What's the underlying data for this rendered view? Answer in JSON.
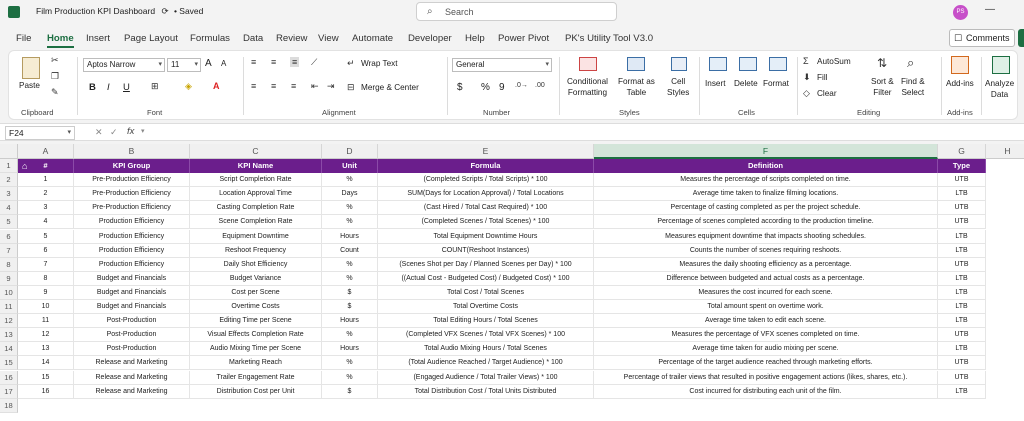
{
  "window": {
    "doc_title": "Film Production KPI Dashboard",
    "saved_status": "• Saved",
    "search_placeholder": "Search",
    "avatar_initials": "PS"
  },
  "menu": {
    "tabs": [
      "File",
      "Home",
      "Insert",
      "Page Layout",
      "Formulas",
      "Data",
      "Review",
      "View",
      "Automate",
      "Developer",
      "Help",
      "Power Pivot",
      "PK's Utility Tool V3.0"
    ],
    "active": "Home",
    "comments_label": "Comments"
  },
  "ribbon": {
    "clipboard": {
      "paste": "Paste",
      "label": "Clipboard"
    },
    "font": {
      "family": "Aptos Narrow",
      "size": "11",
      "label": "Font",
      "grow": "A",
      "shrink": "A",
      "bold": "B",
      "italic": "I",
      "underline": "U"
    },
    "alignment": {
      "wrap_text": "Wrap Text",
      "merge_center": "Merge & Center",
      "label": "Alignment"
    },
    "number": {
      "format": "General",
      "currency": "$",
      "percent": "%",
      "comma": "9",
      "label": "Number"
    },
    "styles": {
      "conditional": "Conditional",
      "conditional2": "Formatting",
      "format_table": "Format as",
      "format_table2": "Table",
      "cell_styles": "Cell",
      "cell_styles2": "Styles",
      "label": "Styles"
    },
    "cells": {
      "insert": "Insert",
      "delete": "Delete",
      "format": "Format",
      "label": "Cells"
    },
    "editing": {
      "autosum": "AutoSum",
      "fill": "Fill",
      "clear": "Clear",
      "sort": "Sort &",
      "sort2": "Filter",
      "find": "Find &",
      "find2": "Select",
      "label": "Editing"
    },
    "addins": {
      "addins": "Add-ins",
      "label": "Add-ins"
    },
    "analyze": {
      "line1": "Analyze",
      "line2": "Data"
    }
  },
  "formula_bar": {
    "name_box": "F24",
    "fx": "fx",
    "value": ""
  },
  "columns": [
    "A",
    "B",
    "C",
    "D",
    "E",
    "F",
    "G",
    "H"
  ],
  "selected_column": "F",
  "header_row": [
    "#",
    "KPI Group",
    "KPI Name",
    "Unit",
    "Formula",
    "Definition",
    "Type"
  ],
  "rows": [
    [
      "1",
      "Pre-Production Efficiency",
      "Script Completion Rate",
      "%",
      "(Completed Scripts / Total Scripts) * 100",
      "Measures the percentage of scripts completed on time.",
      "UTB"
    ],
    [
      "2",
      "Pre-Production Efficiency",
      "Location Approval Time",
      "Days",
      "SUM(Days for Location Approval) / Total Locations",
      "Average time taken to finalize filming locations.",
      "LTB"
    ],
    [
      "3",
      "Pre-Production Efficiency",
      "Casting Completion Rate",
      "%",
      "(Cast Hired / Total Cast Required) * 100",
      "Percentage of casting completed as per the project schedule.",
      "UTB"
    ],
    [
      "4",
      "Production Efficiency",
      "Scene Completion Rate",
      "%",
      "(Completed Scenes / Total Scenes) * 100",
      "Percentage of scenes completed according to the production timeline.",
      "UTB"
    ],
    [
      "5",
      "Production Efficiency",
      "Equipment Downtime",
      "Hours",
      "Total Equipment Downtime Hours",
      "Measures equipment downtime that impacts shooting schedules.",
      "LTB"
    ],
    [
      "6",
      "Production Efficiency",
      "Reshoot Frequency",
      "Count",
      "COUNT(Reshoot Instances)",
      "Counts the number of scenes requiring reshoots.",
      "LTB"
    ],
    [
      "7",
      "Production Efficiency",
      "Daily Shot Efficiency",
      "%",
      "(Scenes Shot per Day / Planned Scenes per Day) * 100",
      "Measures the daily shooting efficiency as a percentage.",
      "UTB"
    ],
    [
      "8",
      "Budget and Financials",
      "Budget Variance",
      "%",
      "((Actual Cost - Budgeted Cost) / Budgeted Cost) * 100",
      "Difference between budgeted and actual costs as a percentage.",
      "LTB"
    ],
    [
      "9",
      "Budget and Financials",
      "Cost per Scene",
      "$",
      "Total Cost / Total Scenes",
      "Measures the cost incurred for each scene.",
      "LTB"
    ],
    [
      "10",
      "Budget and Financials",
      "Overtime Costs",
      "$",
      "Total Overtime Costs",
      "Total amount spent on overtime work.",
      "LTB"
    ],
    [
      "11",
      "Post-Production",
      "Editing Time per Scene",
      "Hours",
      "Total Editing Hours / Total Scenes",
      "Average time taken to edit each scene.",
      "LTB"
    ],
    [
      "12",
      "Post-Production",
      "Visual Effects Completion Rate",
      "%",
      "(Completed VFX Scenes / Total VFX Scenes) * 100",
      "Measures the percentage of VFX scenes completed on time.",
      "UTB"
    ],
    [
      "13",
      "Post-Production",
      "Audio Mixing Time per Scene",
      "Hours",
      "Total Audio Mixing Hours / Total Scenes",
      "Average time taken for audio mixing per scene.",
      "LTB"
    ],
    [
      "14",
      "Release and Marketing",
      "Marketing Reach",
      "%",
      "(Total Audience Reached / Target Audience) * 100",
      "Percentage of the target audience reached through marketing efforts.",
      "UTB"
    ],
    [
      "15",
      "Release and Marketing",
      "Trailer Engagement Rate",
      "%",
      "(Engaged Audience / Total Trailer Views) * 100",
      "Percentage of trailer views that resulted in positive engagement actions (likes, shares, etc.).",
      "UTB"
    ],
    [
      "16",
      "Release and Marketing",
      "Distribution Cost per Unit",
      "$",
      "Total Distribution Cost / Total Units Distributed",
      "Cost incurred for distributing each unit of the film.",
      "LTB"
    ]
  ],
  "row_numbers": [
    "1",
    "2",
    "3",
    "4",
    "5",
    "6",
    "7",
    "8",
    "9",
    "10",
    "11",
    "12",
    "13",
    "14",
    "15",
    "16",
    "17",
    "18"
  ],
  "colors": {
    "header_bg": "#6b1e8c",
    "accent": "#1d6f42"
  }
}
